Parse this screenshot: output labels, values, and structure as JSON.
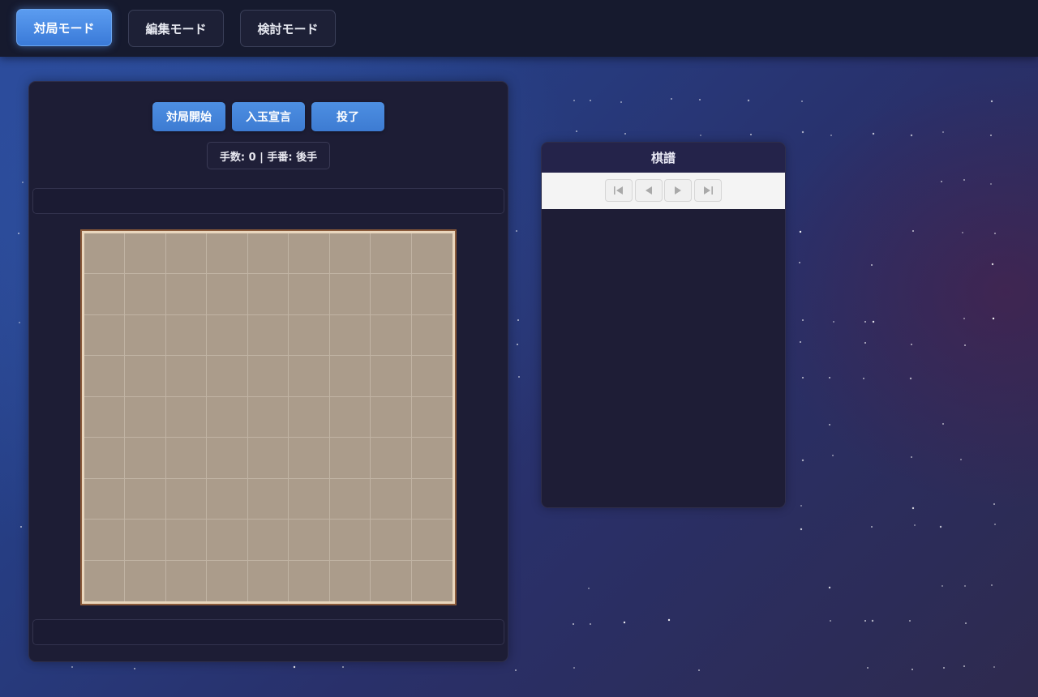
{
  "topbar": {
    "modes": [
      {
        "label": "対局モード",
        "active": true
      },
      {
        "label": "編集モード",
        "active": false
      },
      {
        "label": "検討モード",
        "active": false
      }
    ]
  },
  "game": {
    "buttons": {
      "start": "対局開始",
      "declare": "入玉宣言",
      "resign": "投了"
    },
    "status": "手数: 0 | 手番: 後手"
  },
  "kifu": {
    "title": "棋譜",
    "nav": {
      "first_icon": "skip-to-first-icon",
      "prev_icon": "step-back-icon",
      "next_icon": "step-forward-icon",
      "last_icon": "skip-to-last-icon"
    }
  },
  "colors": {
    "accent": "#4d8fe2",
    "board": "#ab9c8b",
    "panel": "#1d1d35"
  }
}
